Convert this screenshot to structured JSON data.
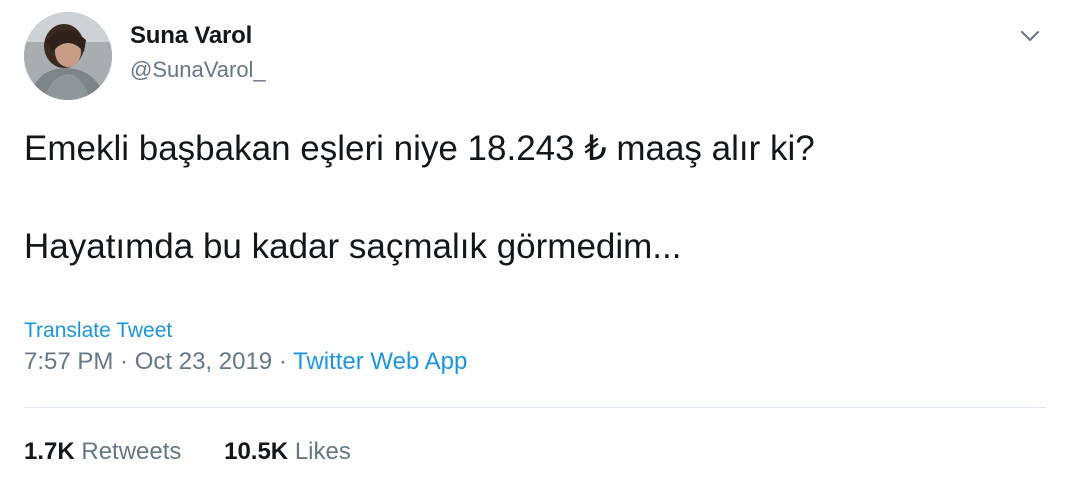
{
  "tweet": {
    "author": {
      "name": "Suna Varol",
      "handle": "@SunaVarol_"
    },
    "text_lines": [
      "Emekli başbakan eşleri niye 18.243 ₺ maaş alır ki?",
      "Hayatımda bu kadar saçmalık görmedim..."
    ],
    "translate_label": "Translate Tweet",
    "time": "7:57 PM",
    "separator": " · ",
    "date": "Oct 23, 2019",
    "source": "Twitter Web App",
    "stats": {
      "retweets_count": "1.7K",
      "retweets_label": "Retweets",
      "likes_count": "10.5K",
      "likes_label": "Likes"
    },
    "icons": {
      "menu": "chevron-down-icon"
    },
    "colors": {
      "link": "#1b95e0",
      "secondary": "#657786",
      "primary": "#14171a",
      "divider": "#e1e8ed"
    }
  }
}
